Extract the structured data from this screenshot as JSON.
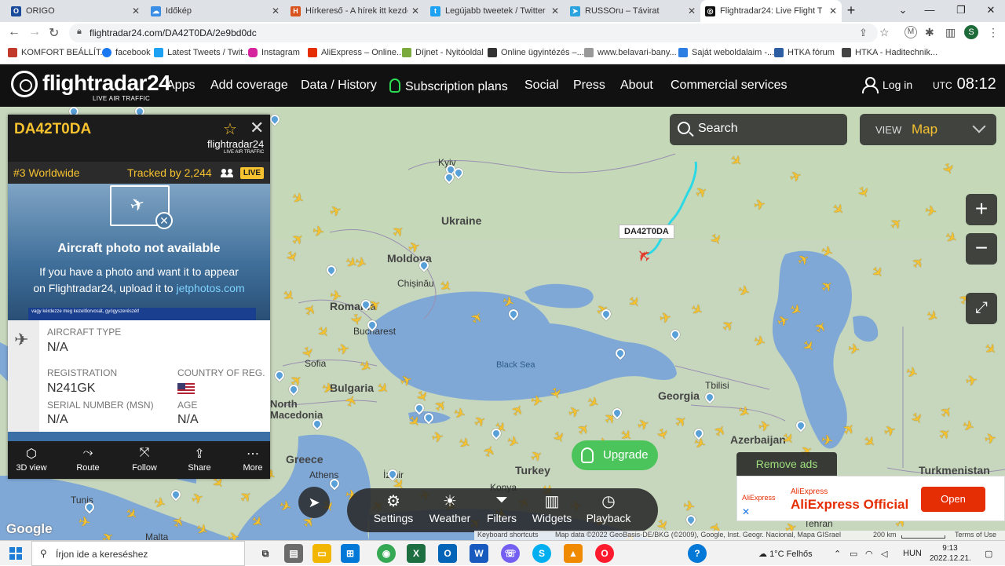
{
  "browser": {
    "tabs": [
      {
        "label": "ORIGO",
        "color": "#1a4b9b",
        "glyph": "O"
      },
      {
        "label": "Időkép",
        "color": "#3a8ee6",
        "glyph": "☁"
      },
      {
        "label": "Hírkereső - A hírek itt kezdőd",
        "color": "#d9531e",
        "glyph": "H"
      },
      {
        "label": "Legújabb tweetek / Twitter",
        "color": "#1da1f2",
        "glyph": "t"
      },
      {
        "label": "RUSSOru – Távirat",
        "color": "#2aa3df",
        "glyph": "➤"
      },
      {
        "label": "Flightradar24: Live Flight Trac",
        "color": "#111111",
        "glyph": "◎"
      }
    ],
    "new_tab": "+",
    "window_controls": [
      "⌄",
      "—",
      "❐",
      "✕"
    ],
    "url": "flightradar24.com/DA42T0DA/2e9bd0dc",
    "profile_initial": "S"
  },
  "bookmarks": [
    {
      "label": "KOMFORT BEÁLLÍT...",
      "color": "#c0392b"
    },
    {
      "label": "facebook",
      "color": "#1877f2"
    },
    {
      "label": "Latest Tweets / Twit...",
      "color": "#1da1f2"
    },
    {
      "label": "Instagram",
      "color": "#d6249f"
    },
    {
      "label": "AliExpress – Online...",
      "color": "#e62e04"
    },
    {
      "label": "Díjnet - Nyitóoldal",
      "color": "#7aa93c"
    },
    {
      "label": "Online ügyintézés –...",
      "color": "#333333"
    },
    {
      "label": "www.belavari-bany...",
      "color": "#999999"
    },
    {
      "label": "Saját weboldalaim -...",
      "color": "#2d7ee3"
    },
    {
      "label": "HTKA fórum",
      "color": "#2d5ea3"
    },
    {
      "label": "HTKA - Haditechnik...",
      "color": "#444444"
    }
  ],
  "fr24": {
    "logo": "flightradar24",
    "logo_sub": "LIVE AIR TRAFFIC",
    "nav": [
      "Apps",
      "Add coverage",
      "Data / History",
      "Subscription plans",
      "Social",
      "Press",
      "About",
      "Commercial services"
    ],
    "login": "Log in",
    "utc_label": "UTC",
    "time": "08:12"
  },
  "map": {
    "search_label": "Search",
    "view_label": "VIEW",
    "view_value": "Map",
    "labels": [
      {
        "text": "Kyiv",
        "bold": false
      },
      {
        "text": "Ukraine",
        "bold": true
      },
      {
        "text": "Moldova",
        "bold": true
      },
      {
        "text": "Chișinău",
        "bold": false
      },
      {
        "text": "Black Sea",
        "bold": false
      },
      {
        "text": "Romania",
        "bold": true
      },
      {
        "text": "Bucharest",
        "bold": false
      },
      {
        "text": "Bulgaria",
        "bold": true
      },
      {
        "text": "Sofia",
        "bold": false
      },
      {
        "text": "North Macedonia",
        "bold": true
      },
      {
        "text": "Greece",
        "bold": true
      },
      {
        "text": "Athens",
        "bold": false
      },
      {
        "text": "İzmir",
        "bold": false
      },
      {
        "text": "Turkey",
        "bold": true
      },
      {
        "text": "Konya",
        "bold": false
      },
      {
        "text": "Tunis",
        "bold": false
      },
      {
        "text": "Malta",
        "bold": false
      },
      {
        "text": "Georgia",
        "bold": true
      },
      {
        "text": "Tbilisi",
        "bold": false
      },
      {
        "text": "Azerbaijan",
        "bold": true
      },
      {
        "text": "Tehran",
        "bold": false
      },
      {
        "text": "Turkmenistan",
        "bold": true
      }
    ],
    "tracked_callsign": "DA42T0DA",
    "upgrade": "Upgrade",
    "google": "Google",
    "footer": {
      "shortcuts": "Keyboard shortcuts",
      "attribution": "Map data ©2022 GeoBasis-DE/BKG (©2009), Google, Inst. Geogr. Nacional, Mapa GISrael",
      "scale": "200 km",
      "terms": "Terms of Use"
    }
  },
  "panel": {
    "callsign": "DA42T0DA",
    "brand": "flightradar24",
    "brand_sub": "LIVE AIR TRAFFIC",
    "rank": "#3 Worldwide",
    "tracked": "Tracked by 2,244",
    "live": "LIVE",
    "photo_title": "Aircraft photo not available",
    "photo_text_1": "If you have a photo and want it to appear",
    "photo_text_2": "on Flightradar24, upload it to ",
    "photo_link": "jetphotos.com",
    "photo_strip": "vagy kérdezze meg kezelőorvosát, gyógyszerészét!",
    "aircraft_type_label": "AIRCRAFT TYPE",
    "aircraft_type": "N/A",
    "registration_label": "REGISTRATION",
    "registration": "N241GK",
    "country_label": "COUNTRY OF REG.",
    "serial_label": "SERIAL NUMBER (MSN)",
    "serial": "N/A",
    "age_label": "AGE",
    "age": "N/A",
    "actions": [
      "3D view",
      "Route",
      "Follow",
      "Share",
      "More"
    ]
  },
  "toolbar": [
    "Settings",
    "Weather",
    "Filters",
    "Widgets",
    "Playback"
  ],
  "ad": {
    "remove": "Remove ads",
    "advertiser": "AliExpress",
    "logo": "AliExpress",
    "title": "AliExpress Official",
    "button": "Open"
  },
  "taskbar": {
    "search_placeholder": "Írjon ide a kereséshez",
    "weather": "1°C  Felhős",
    "lang": "HUN",
    "time": "9:13",
    "date": "2022.12.21."
  }
}
